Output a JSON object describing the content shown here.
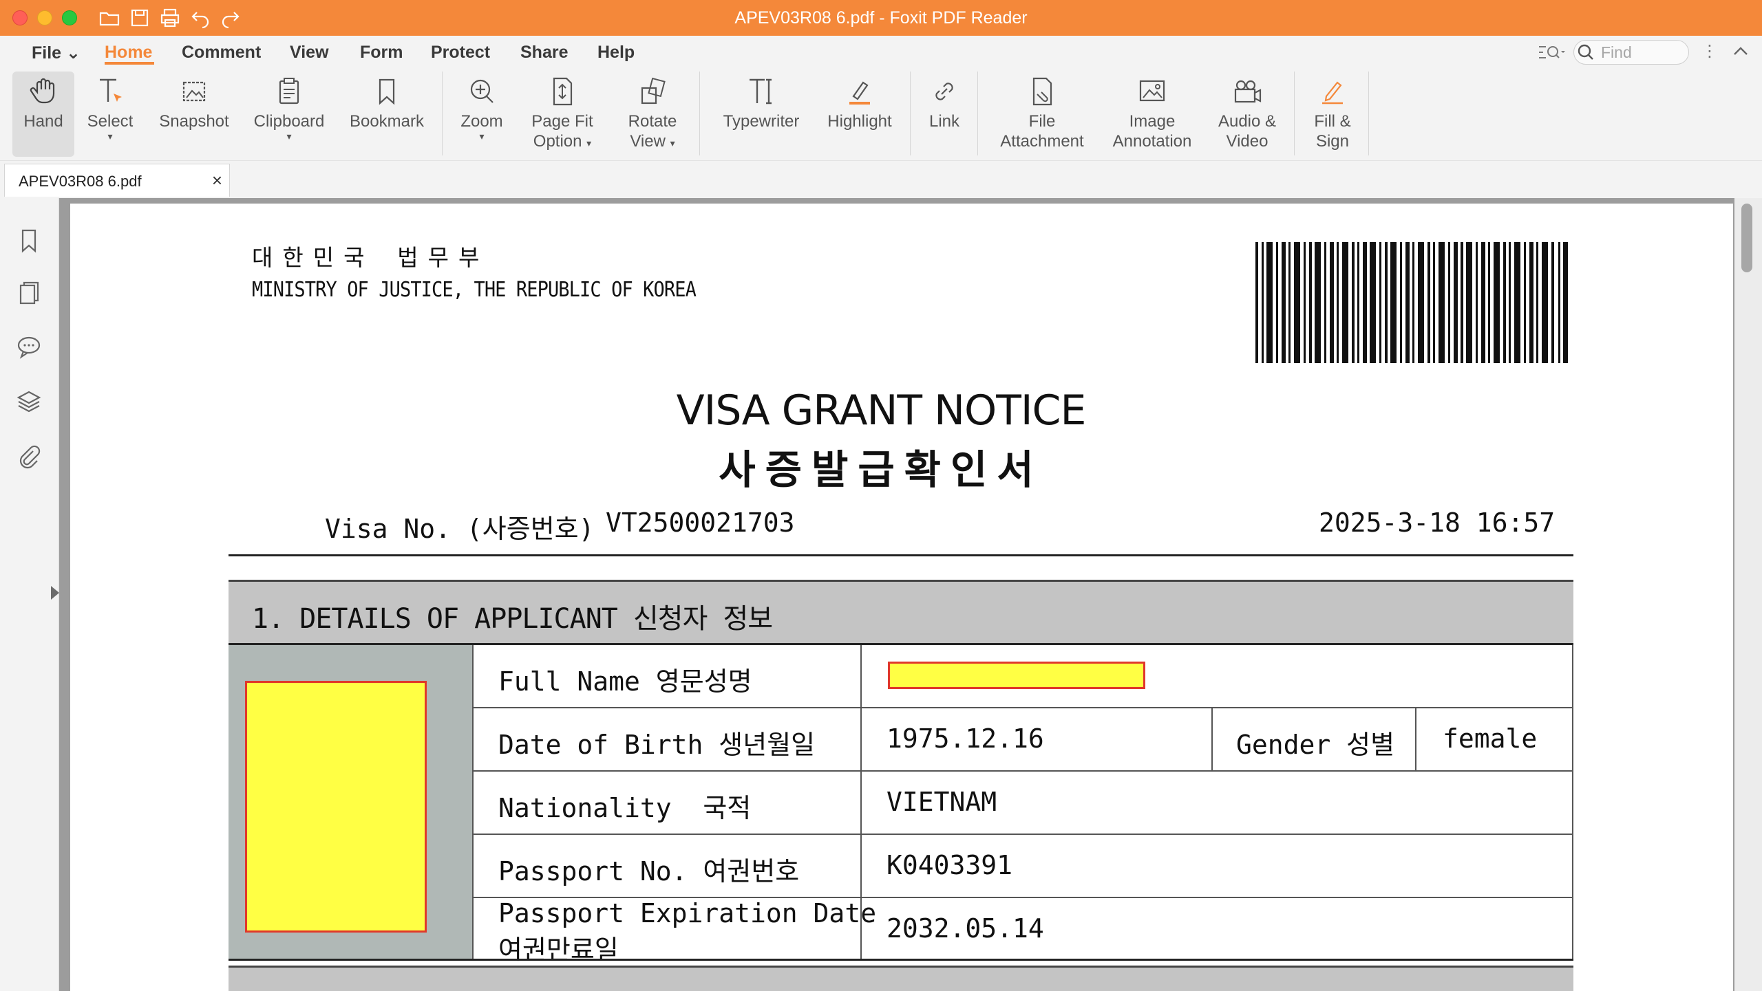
{
  "window": {
    "title": "APEV03R08 6.pdf - Foxit PDF Reader"
  },
  "menu": {
    "items": [
      "File",
      "Home",
      "Comment",
      "View",
      "Form",
      "Protect",
      "Share",
      "Help"
    ],
    "active": "Home",
    "find_placeholder": "Find"
  },
  "ribbon": {
    "hand": "Hand",
    "select": "Select",
    "snapshot": "Snapshot",
    "clipboard": "Clipboard",
    "bookmark": "Bookmark",
    "zoom": "Zoom",
    "page_fit_1": "Page Fit",
    "page_fit_2": "Option",
    "rotate_1": "Rotate",
    "rotate_2": "View",
    "typewriter": "Typewriter",
    "highlight": "Highlight",
    "link": "Link",
    "file_attach_1": "File",
    "file_attach_2": "Attachment",
    "image_annot_1": "Image",
    "image_annot_2": "Annotation",
    "audio_1": "Audio &",
    "audio_2": "Video",
    "fill_1": "Fill &",
    "fill_2": "Sign"
  },
  "tab": {
    "label": "APEV03R08 6.pdf",
    "close": "×"
  },
  "document": {
    "ministry_kr": "대한민국 법무부",
    "ministry_en": "MINISTRY OF JUSTICE, THE REPUBLIC OF KOREA",
    "title_en": "VISA GRANT NOTICE",
    "title_kr": "사증발급확인서",
    "visa_label": "Visa No. (사증번호)",
    "visa_number": "VT2500021703",
    "issue_datetime": "2025-3-18 16:57",
    "section_title": "1. DETAILS OF APPLICANT 신청자 정보",
    "fields": {
      "full_name_label": "Full Name 영문성명",
      "dob_label": "Date of Birth 생년월일",
      "dob_value": "1975.12.16",
      "gender_label": "Gender 성별",
      "gender_value": "female",
      "nationality_label": "Nationality  국적",
      "nationality_value": "VIETNAM",
      "passport_label": "Passport No. 여권번호",
      "passport_value": "K0403391",
      "expiry_label_1": "Passport Expiration Date",
      "expiry_label_2": "여권만료일",
      "expiry_value": "2032.05.14"
    }
  },
  "colors": {
    "accent": "#f4883a",
    "redaction_fill": "#ffff44",
    "redaction_border": "#e0382a"
  }
}
